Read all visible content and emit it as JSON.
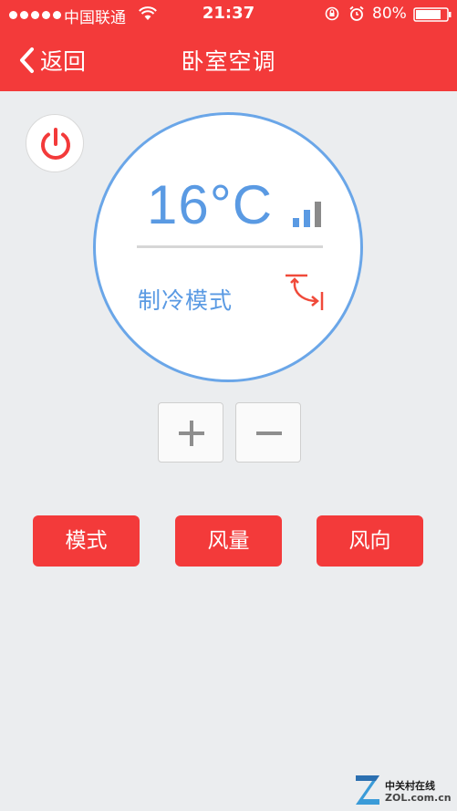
{
  "status_bar": {
    "carrier": "中国联通",
    "time": "21:37",
    "battery": "80%",
    "icons": [
      "signal-dots-icon",
      "wifi-icon",
      "orientation-lock-icon",
      "alarm-icon",
      "battery-icon"
    ]
  },
  "nav": {
    "back_label": "返回",
    "title": "卧室空调"
  },
  "ac": {
    "temperature": "16°C",
    "fan_level_bars": 3,
    "mode": "制冷模式",
    "power_icon": "power-icon",
    "swing_icon": "swing-icon"
  },
  "stepper": {
    "plus_icon": "plus-icon",
    "minus_icon": "minus-icon"
  },
  "actions": {
    "mode_label": "模式",
    "fan_label": "风量",
    "direction_label": "风向"
  },
  "watermark": {
    "cn": "中关村在线",
    "en": "ZOL.com.cn"
  },
  "colors": {
    "brand_red": "#f33a3a",
    "accent_blue": "#5a9ae3",
    "background": "#ebedef"
  }
}
